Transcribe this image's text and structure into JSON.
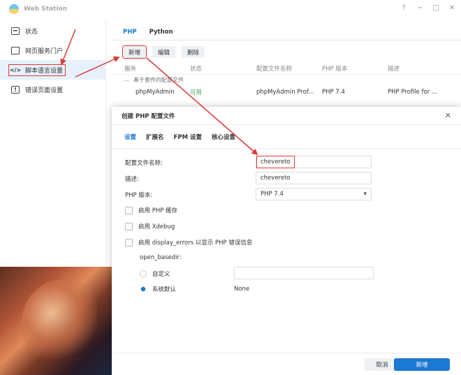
{
  "window": {
    "title": "Web Station",
    "controls": [
      "?",
      "−",
      "□",
      "✕"
    ]
  },
  "sidebar": {
    "items": [
      {
        "label": "状态",
        "icon": "status-icon"
      },
      {
        "label": "网页服务门户",
        "icon": "portal-icon"
      },
      {
        "label": "脚本语言设置",
        "icon": "code-icon"
      },
      {
        "label": "错误页面设置",
        "icon": "error-page-icon"
      }
    ]
  },
  "main": {
    "tabs": [
      "PHP",
      "Python"
    ],
    "toolbar": {
      "add": "新增",
      "edit": "编辑",
      "delete": "删除"
    },
    "table": {
      "columns": [
        "服务",
        "状态",
        "配置文件名称",
        "PHP 版本",
        "描述"
      ],
      "group_label": "基于套件的配置文件",
      "rows": [
        {
          "service": "phpMyAdmin",
          "status": "可用",
          "profile": "phpMyAdmin Prof...",
          "version": "PHP 7.4",
          "desc": "PHP Profile for ..."
        }
      ]
    }
  },
  "dialog": {
    "title": "创建 PHP 配置文件",
    "close": "✕",
    "tabs": [
      "设置",
      "扩展名",
      "FPM 设置",
      "核心设置"
    ],
    "fields": {
      "profile_name_label": "配置文件名称:",
      "profile_name_value": "chevereto",
      "desc_label": "描述:",
      "desc_value": "chevereto",
      "version_label": "PHP 版本:",
      "version_value": "PHP 7.4"
    },
    "checkboxes": [
      "启用 PHP 缓存",
      "启用 Xdebug",
      "启用 display_errors 以显示 PHP 错误信息"
    ],
    "open_basedir_label": "open_basedir:",
    "radios": {
      "custom": "自定义",
      "default": "系统默认",
      "default_value": "None"
    },
    "footer": {
      "cancel": "取消",
      "ok": "新增"
    }
  },
  "colors": {
    "accent": "#1b78d3",
    "annotation": "#d93a3a",
    "available": "#3aa757"
  }
}
